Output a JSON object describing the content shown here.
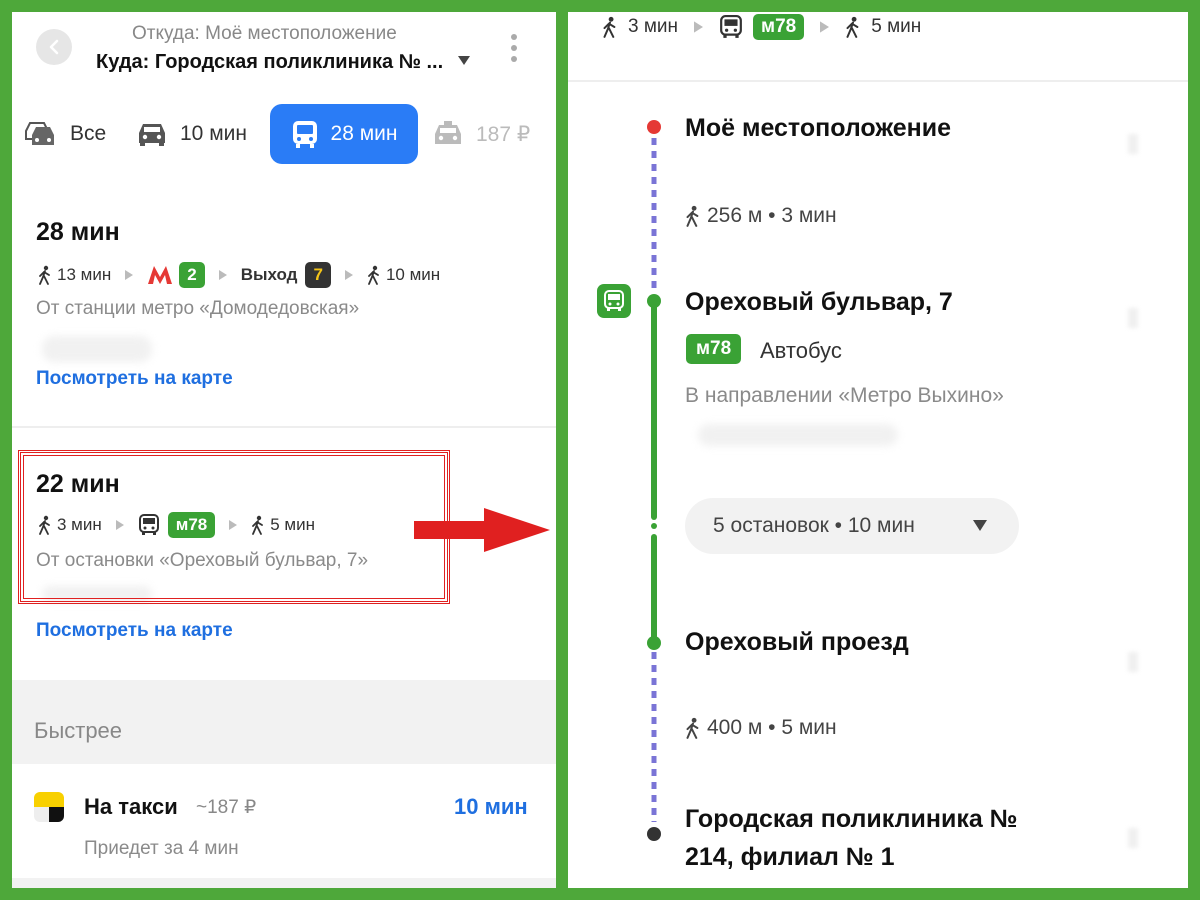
{
  "left": {
    "header": {
      "from": "Откуда: Моё местоположение",
      "to": "Куда: Городская поликлиника № ..."
    },
    "modes": [
      {
        "label": "Все"
      },
      {
        "label": "10 мин"
      },
      {
        "label": "28 мин",
        "active": true
      },
      {
        "label": "187 ₽"
      }
    ],
    "routes": [
      {
        "title": "28 мин",
        "walk1": "13 мин",
        "metro_line": "2",
        "exit_label": "Выход",
        "exit_num": "7",
        "walk2": "10 мин",
        "subtitle": "От станции метро «Домодедовская»",
        "map_link": "Посмотреть на карте"
      },
      {
        "title": "22 мин",
        "walk1": "3 мин",
        "bus_route": "м78",
        "walk2": "5 мин",
        "subtitle": "От остановки «Ореховый бульвар, 7»",
        "map_link": "Посмотреть на карте"
      }
    ],
    "faster": {
      "label": "Быстрее",
      "taxi_title": "На такси",
      "taxi_price": "~187 ₽",
      "taxi_time": "10 мин",
      "taxi_arrive": "Приедет за 4 мин"
    }
  },
  "right": {
    "summary": {
      "walk1": "3 мин",
      "bus_route": "м78",
      "walk2": "5 мин"
    },
    "start": "Моё местоположение",
    "walk_a": "256 м • 3 мин",
    "board_stop": "Ореховый бульвар, 7",
    "bus_route": "м78",
    "bus_label": "Автобус",
    "direction": "В направлении «Метро Выхино»",
    "stops_summary": "5 остановок • 10 мин",
    "alight_stop": "Ореховый проезд",
    "walk_b": "400 м • 5 мин",
    "destination_line1": "Городская поликлиника №",
    "destination_line2": "214, филиал № 1"
  },
  "colors": {
    "accent_blue": "#2a7cf6",
    "link_blue": "#1f6fe0",
    "bus_green": "#3aa235",
    "walk_dash": "#7a74d6",
    "start_red": "#e53935",
    "arrow_red": "#e02020",
    "frame_green": "#4ea83a"
  }
}
